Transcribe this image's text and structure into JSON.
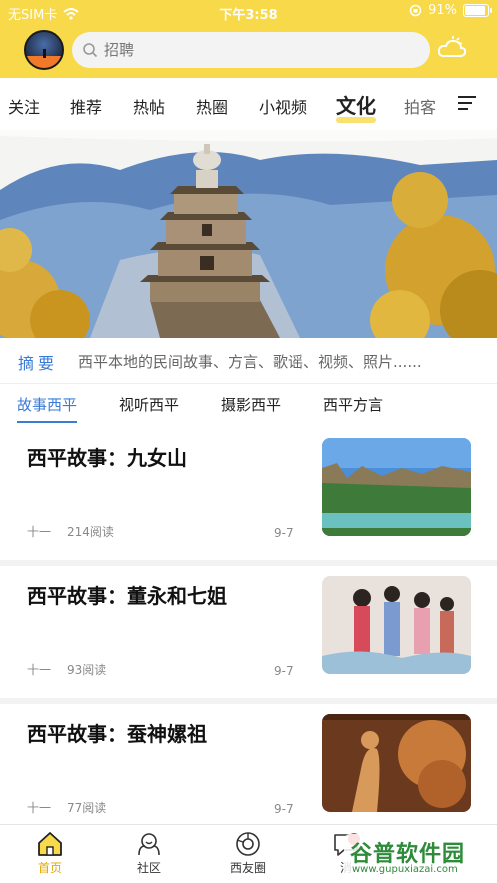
{
  "status": {
    "carrier": "无SIM卡",
    "time": "下午3:58",
    "battery": "91%",
    "battery_level": 0.91
  },
  "search": {
    "placeholder": "招聘"
  },
  "tabs": [
    {
      "label": "关注"
    },
    {
      "label": "推荐"
    },
    {
      "label": "热帖"
    },
    {
      "label": "热圈"
    },
    {
      "label": "小视频"
    },
    {
      "label": "文化"
    },
    {
      "label": "拍客"
    }
  ],
  "summary": {
    "label": "摘要",
    "text": "西平本地的民间故事、方言、歌谣、视频、照片......"
  },
  "subtabs": [
    {
      "label": "故事西平"
    },
    {
      "label": "视听西平"
    },
    {
      "label": "摄影西平"
    },
    {
      "label": "西平方言"
    }
  ],
  "articles": [
    {
      "title": "西平故事：九女山",
      "author": "十一",
      "reads": "214阅读",
      "date": "9-7"
    },
    {
      "title": "西平故事：董永和七姐",
      "author": "十一",
      "reads": "93阅读",
      "date": "9-7"
    },
    {
      "title": "西平故事：蚕神嫘祖",
      "author": "十一",
      "reads": "77阅读",
      "date": "9-7"
    }
  ],
  "nav": [
    {
      "label": "首页"
    },
    {
      "label": "社区"
    },
    {
      "label": "西友圈"
    },
    {
      "label": "消"
    }
  ],
  "watermark": {
    "text": "谷普软件园",
    "url": "www.gupuxiazai.com"
  },
  "colors": {
    "accent": "#f7d94a",
    "link": "#3a7bd5"
  }
}
